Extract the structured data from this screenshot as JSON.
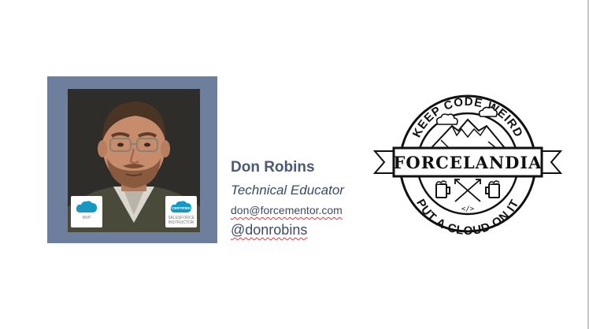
{
  "profile": {
    "name": "Don Robins",
    "title": "Technical Educator",
    "email": "don@forcementor.com",
    "handle": "@donrobins"
  },
  "badges": {
    "mvp": {
      "brand": "salesforce",
      "label": "MVP"
    },
    "certified": {
      "brand": "CERTIFIED",
      "label": "SALESFORCE INSTRUCTOR"
    }
  },
  "logo": {
    "top_text": "KEEP CODE WEIRD",
    "banner_text": "FORCELANDIA",
    "bottom_text": "PUT A CLOUD ON IT",
    "code_glyph": "</>"
  },
  "colors": {
    "frame": "#6d7f9c",
    "name_text": "#4a5a75",
    "body_text": "#3b4a66",
    "badge_cloud": "#1798c1",
    "spellcheck": "#d04040"
  }
}
